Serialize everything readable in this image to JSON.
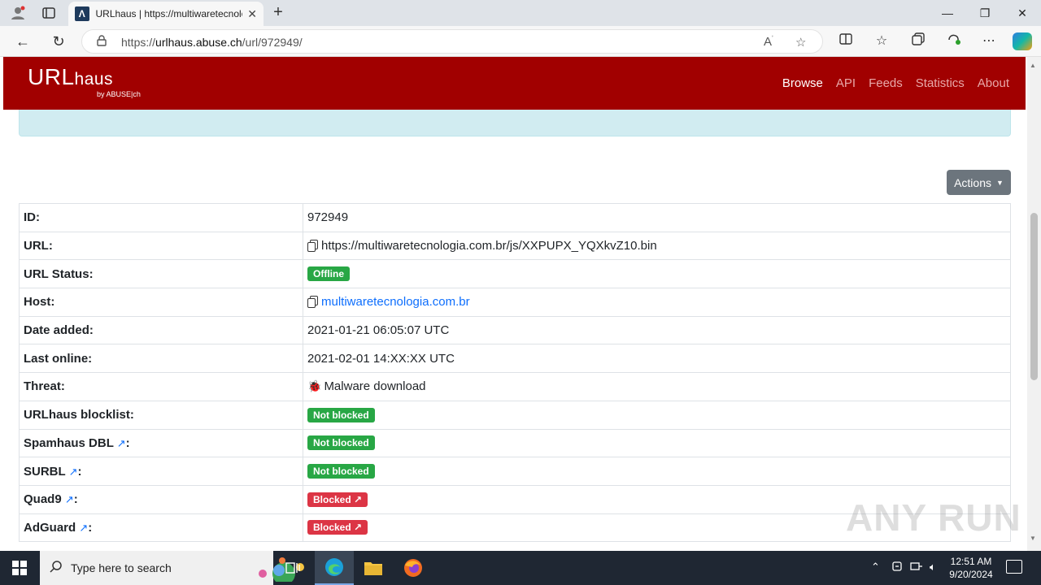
{
  "browser": {
    "tab_title": "URLhaus | https://multiwaretecnolo",
    "tab_favicon": "Λ",
    "url_prefix": "https://",
    "url_domain": "urlhaus.abuse.ch",
    "url_path": "/url/972949/"
  },
  "site": {
    "logo_main": "URL",
    "logo_haus": "haus",
    "logo_by": "by ABUSE|ch",
    "nav": [
      "Browse",
      "API",
      "Feeds",
      "Statistics",
      "About"
    ],
    "actions_label": "Actions"
  },
  "details": {
    "id_label": "ID:",
    "id_value": "972949",
    "url_label": "URL:",
    "url_value": "https://multiwaretecnologia.com.br/js/XXPUPX_YQXkvZ10.bin",
    "status_label": "URL Status:",
    "status_value": "Offline",
    "host_label": "Host:",
    "host_value": "multiwaretecnologia.com.br",
    "date_added_label": "Date added:",
    "date_added_value": "2021-01-21 06:05:07 UTC",
    "last_online_label": "Last online:",
    "last_online_value": "2021-02-01 14:XX:XX UTC",
    "threat_label": "Threat:",
    "threat_value": "Malware download",
    "blocklist_label": "URLhaus blocklist:",
    "blocklist_value": "Not blocked",
    "spamhaus_label": "Spamhaus DBL",
    "spamhaus_value": "Not blocked",
    "surbl_label": "SURBL",
    "surbl_value": "Not blocked",
    "quad9_label": "Quad9",
    "quad9_value": "Blocked",
    "adguard_label": "AdGuard",
    "adguard_value": "Blocked"
  },
  "watermark": "ANY RUN",
  "taskbar": {
    "search_placeholder": "Type here to search",
    "time": "12:51 AM",
    "date": "9/20/2024"
  },
  "colors": {
    "brand_red": "#a10000",
    "badge_green": "#28a745",
    "badge_red": "#dc3545",
    "link_blue": "#0d6efd"
  }
}
